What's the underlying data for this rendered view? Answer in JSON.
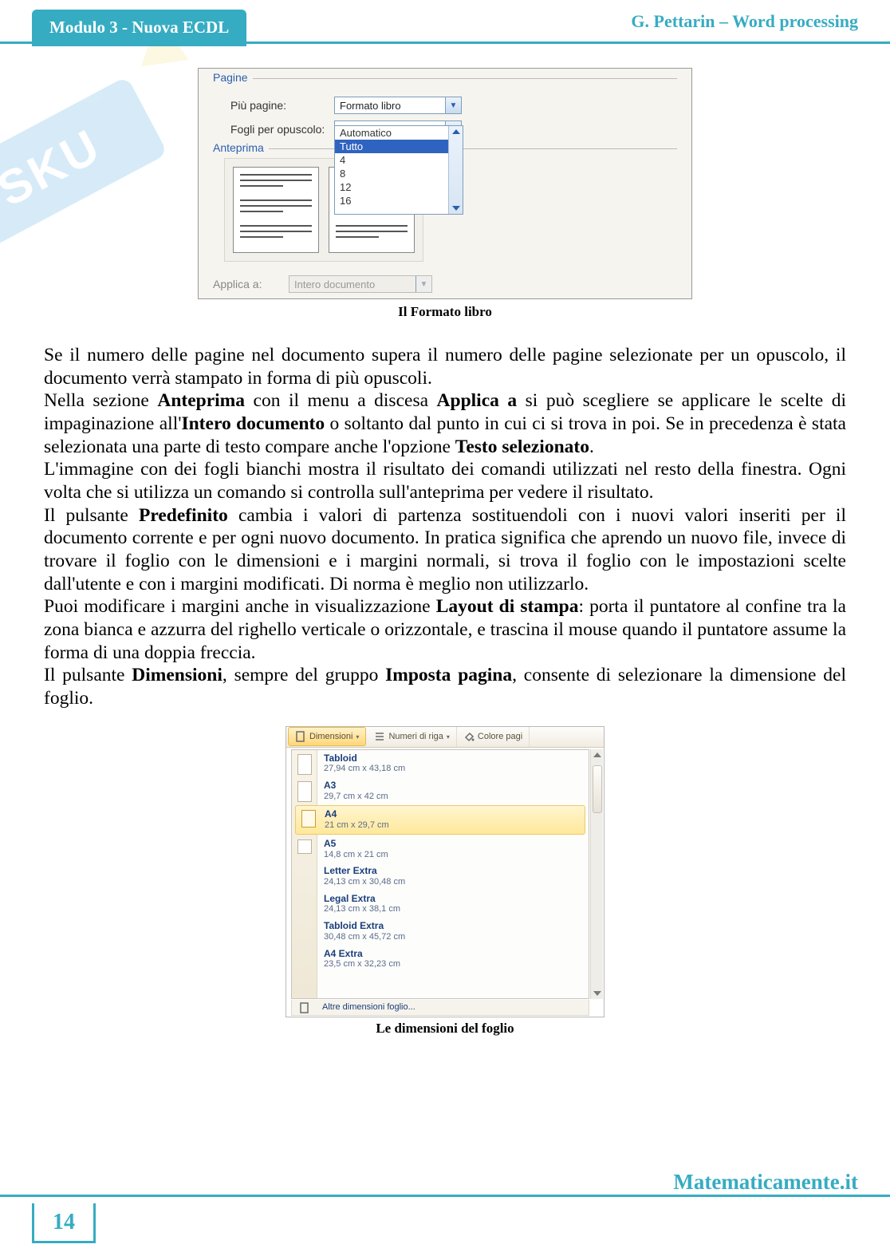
{
  "header": {
    "tab": "Modulo 3 - Nuova ECDL",
    "right": "G. Pettarin – Word processing"
  },
  "fig1": {
    "group_pages": "Pagine",
    "lbl_multi": "Più pagine:",
    "val_multi": "Formato libro",
    "lbl_sheets": "Fogli per opuscolo:",
    "val_sheets": "Tutto",
    "options": [
      "Automatico",
      "Tutto",
      "4",
      "8",
      "12",
      "16"
    ],
    "selected_index": 1,
    "group_preview": "Anteprima",
    "lbl_apply": "Applica a:",
    "val_apply": "Intero documento",
    "caption": "Il Formato libro"
  },
  "body": {
    "p1a": "Se il numero delle pagine nel documento supera il numero delle pagine selezionate per un opuscolo, il documento verrà stampato in forma di più opuscoli.",
    "p2a": "Nella sezione ",
    "p2b": "Anteprima",
    "p2c": " con il menu a discesa ",
    "p2d": "Applica a",
    "p2e": " si può scegliere se applicare le scelte di impaginazione all'",
    "p2f": "Intero documento",
    "p2g": " o soltanto dal punto in cui ci si trova in poi. Se in precedenza è stata selezionata una parte di testo compare anche l'opzione ",
    "p2h": "Testo selezionato",
    "p2i": ".",
    "p3": "L'immagine con dei fogli bianchi mostra il risultato dei comandi utilizzati nel resto della finestra. Ogni volta che si utilizza un comando si controlla sull'anteprima per vedere il risultato.",
    "p4a": "Il pulsante ",
    "p4b": "Predefinito",
    "p4c": " cambia i valori di partenza sostituendoli con i nuovi valori inseriti per il documento corrente e per ogni nuovo documento. In pratica significa che aprendo un nuovo file, invece di trovare il foglio con le dimensioni e i margini normali, si trova il foglio con le impostazioni scelte dall'utente e con i margini modificati. Di norma è meglio non utilizzarlo.",
    "p5a": "Puoi modificare i margini anche in visualizzazione ",
    "p5b": "Layout di stampa",
    "p5c": ": porta il puntatore al confine tra la zona bianca e azzurra del righello verticale o orizzontale, e trascina il mouse quando il puntatore assume la forma di una doppia freccia.",
    "p6a": "Il pulsante ",
    "p6b": "Dimensioni",
    "p6c": ", sempre del gruppo ",
    "p6d": "Imposta pagina",
    "p6e": ", consente di selezionare la dimensione del foglio."
  },
  "fig2": {
    "rib": {
      "dim": "Dimensioni",
      "num": "Numeri di riga",
      "col": "Colore pagi"
    },
    "items": [
      {
        "nm": "Tabloid",
        "sz": "27,94 cm x 43,18 cm"
      },
      {
        "nm": "A3",
        "sz": "29,7 cm x 42 cm"
      },
      {
        "nm": "A4",
        "sz": "21 cm x 29,7 cm"
      },
      {
        "nm": "A5",
        "sz": "14,8 cm x 21 cm"
      },
      {
        "nm": "Letter Extra",
        "sz": "24,13 cm x 30,48 cm"
      },
      {
        "nm": "Legal Extra",
        "sz": "24,13 cm x 38,1 cm"
      },
      {
        "nm": "Tabloid Extra",
        "sz": "30,48 cm x 45,72 cm"
      },
      {
        "nm": "A4 Extra",
        "sz": "23,5 cm x 32,23 cm"
      }
    ],
    "selected_index": 2,
    "foot": "Altre dimensioni foglio...",
    "caption": "Le dimensioni del foglio"
  },
  "footer": {
    "site": "Matematicamente.it",
    "page": "14"
  },
  "watermark": "SKU"
}
